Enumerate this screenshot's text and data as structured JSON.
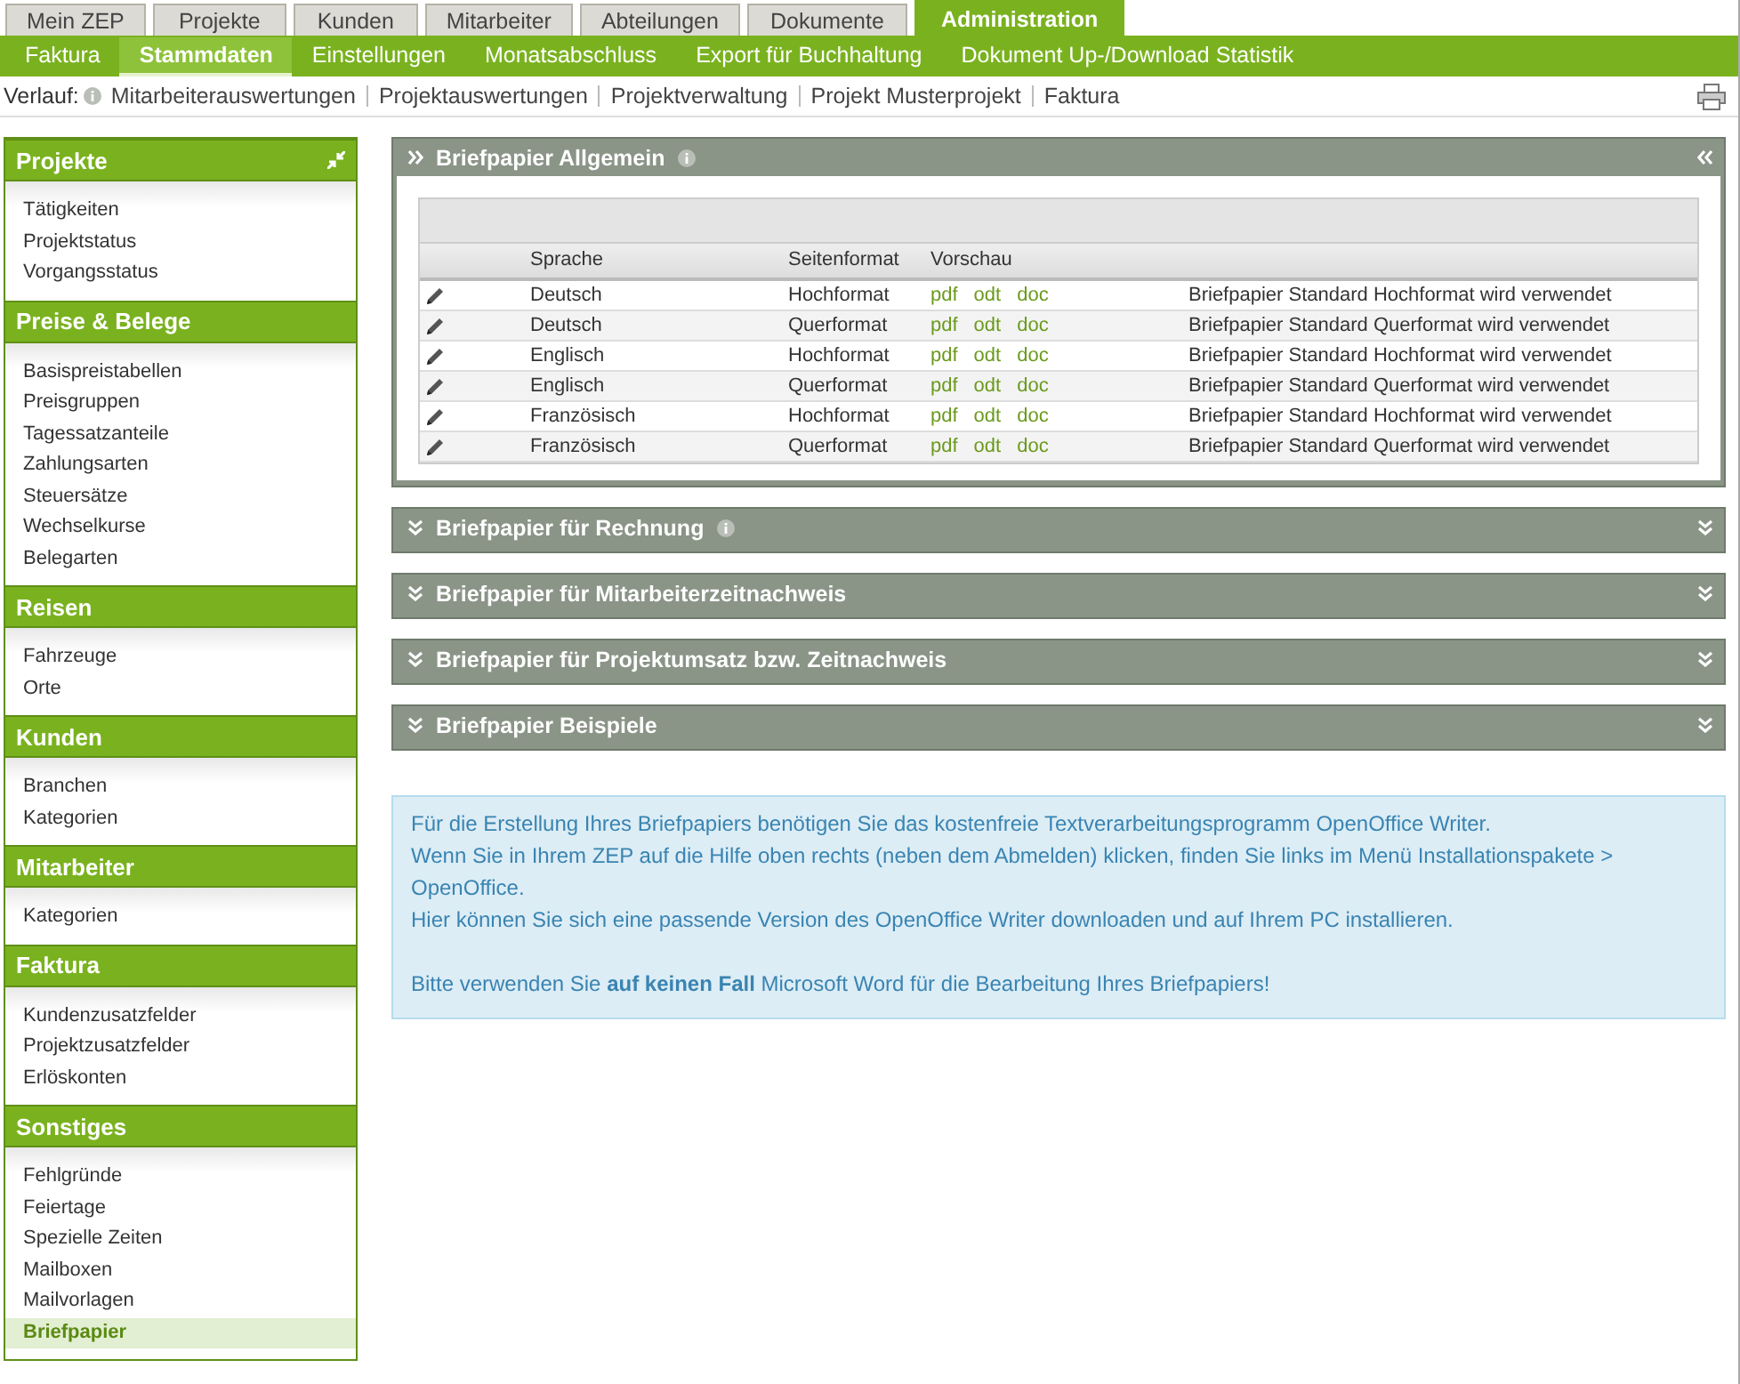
{
  "top_tabs": [
    {
      "label": "Mein ZEP",
      "selected": false
    },
    {
      "label": "Projekte",
      "selected": false
    },
    {
      "label": "Kunden",
      "selected": false
    },
    {
      "label": "Mitarbeiter",
      "selected": false
    },
    {
      "label": "Abteilungen",
      "selected": false
    },
    {
      "label": "Dokumente",
      "selected": false
    },
    {
      "label": "Administration",
      "selected": true
    }
  ],
  "sub_tabs": [
    {
      "label": "Faktura",
      "selected": false
    },
    {
      "label": "Stammdaten",
      "selected": true
    },
    {
      "label": "Einstellungen",
      "selected": false
    },
    {
      "label": "Monatsabschluss",
      "selected": false
    },
    {
      "label": "Export für Buchhaltung",
      "selected": false
    },
    {
      "label": "Dokument Up-/Download Statistik",
      "selected": false
    }
  ],
  "breadcrumb": {
    "label": "Verlauf:",
    "items": [
      "Mitarbeiterauswertungen",
      "Projektauswertungen",
      "Projektverwaltung",
      "Projekt Musterprojekt",
      "Faktura"
    ]
  },
  "sidebar": {
    "groups": [
      {
        "title": "Projekte",
        "collapse_icon": true,
        "items": [
          {
            "label": "Tätigkeiten",
            "selected": false
          },
          {
            "label": "Projektstatus",
            "selected": false
          },
          {
            "label": "Vorgangsstatus",
            "selected": false
          }
        ]
      },
      {
        "title": "Preise & Belege",
        "collapse_icon": false,
        "items": [
          {
            "label": "Basispreistabellen",
            "selected": false
          },
          {
            "label": "Preisgruppen",
            "selected": false
          },
          {
            "label": "Tagessatzanteile",
            "selected": false
          },
          {
            "label": "Zahlungsarten",
            "selected": false
          },
          {
            "label": "Steuersätze",
            "selected": false
          },
          {
            "label": "Wechselkurse",
            "selected": false
          },
          {
            "label": "Belegarten",
            "selected": false
          }
        ]
      },
      {
        "title": "Reisen",
        "collapse_icon": false,
        "items": [
          {
            "label": "Fahrzeuge",
            "selected": false
          },
          {
            "label": "Orte",
            "selected": false
          }
        ]
      },
      {
        "title": "Kunden",
        "collapse_icon": false,
        "items": [
          {
            "label": "Branchen",
            "selected": false
          },
          {
            "label": "Kategorien",
            "selected": false
          }
        ]
      },
      {
        "title": "Mitarbeiter",
        "collapse_icon": false,
        "items": [
          {
            "label": "Kategorien",
            "selected": false
          }
        ]
      },
      {
        "title": "Faktura",
        "collapse_icon": false,
        "items": [
          {
            "label": "Kundenzusatzfelder",
            "selected": false
          },
          {
            "label": "Projektzusatzfelder",
            "selected": false
          },
          {
            "label": "Erlöskonten",
            "selected": false
          }
        ]
      },
      {
        "title": "Sonstiges",
        "collapse_icon": false,
        "items": [
          {
            "label": "Fehlgründe",
            "selected": false
          },
          {
            "label": "Feiertage",
            "selected": false
          },
          {
            "label": "Spezielle Zeiten",
            "selected": false
          },
          {
            "label": "Mailboxen",
            "selected": false
          },
          {
            "label": "Mailvorlagen",
            "selected": false
          },
          {
            "label": "Briefpapier",
            "selected": true
          }
        ]
      }
    ]
  },
  "panels": [
    {
      "title": "Briefpapier Allgemein",
      "info": true,
      "expanded": true,
      "table": {
        "columns": [
          "Sprache",
          "Seitenformat",
          "Vorschau"
        ],
        "rows": [
          {
            "language": "Deutsch",
            "format": "Hochformat",
            "links": [
              "pdf",
              "odt",
              "doc"
            ],
            "status": "Briefpapier Standard Hochformat wird verwendet"
          },
          {
            "language": "Deutsch",
            "format": "Querformat",
            "links": [
              "pdf",
              "odt",
              "doc"
            ],
            "status": "Briefpapier Standard Querformat wird verwendet"
          },
          {
            "language": "Englisch",
            "format": "Hochformat",
            "links": [
              "pdf",
              "odt",
              "doc"
            ],
            "status": "Briefpapier Standard Hochformat wird verwendet"
          },
          {
            "language": "Englisch",
            "format": "Querformat",
            "links": [
              "pdf",
              "odt",
              "doc"
            ],
            "status": "Briefpapier Standard Querformat wird verwendet"
          },
          {
            "language": "Französisch",
            "format": "Hochformat",
            "links": [
              "pdf",
              "odt",
              "doc"
            ],
            "status": "Briefpapier Standard Hochformat wird verwendet"
          },
          {
            "language": "Französisch",
            "format": "Querformat",
            "links": [
              "pdf",
              "odt",
              "doc"
            ],
            "status": "Briefpapier Standard Querformat wird verwendet"
          }
        ]
      }
    },
    {
      "title": "Briefpapier für Rechnung",
      "info": true,
      "expanded": false
    },
    {
      "title": "Briefpapier für Mitarbeiterzeitnachweis",
      "info": false,
      "expanded": false
    },
    {
      "title": "Briefpapier für Projektumsatz bzw. Zeitnachweis",
      "info": false,
      "expanded": false
    },
    {
      "title": "Briefpapier Beispiele",
      "info": false,
      "expanded": false
    }
  ],
  "notice": {
    "paragraphs": [
      "Für die Erstellung Ihres Briefpapiers benötigen Sie das kostenfreie Textverarbeitungsprogramm OpenOffice Writer.",
      "Wenn Sie in Ihrem ZEP auf die Hilfe oben rechts (neben dem Abmelden) klicken, finden Sie links im Menü Installationspakete > OpenOffice.",
      "Hier können Sie sich eine passende Version des OpenOffice Writer downloaden und auf Ihrem PC installieren.",
      "Bitte verwenden Sie **auf keinen Fall** Microsoft Word für die Bearbeitung Ihres Briefpapiers!"
    ]
  }
}
